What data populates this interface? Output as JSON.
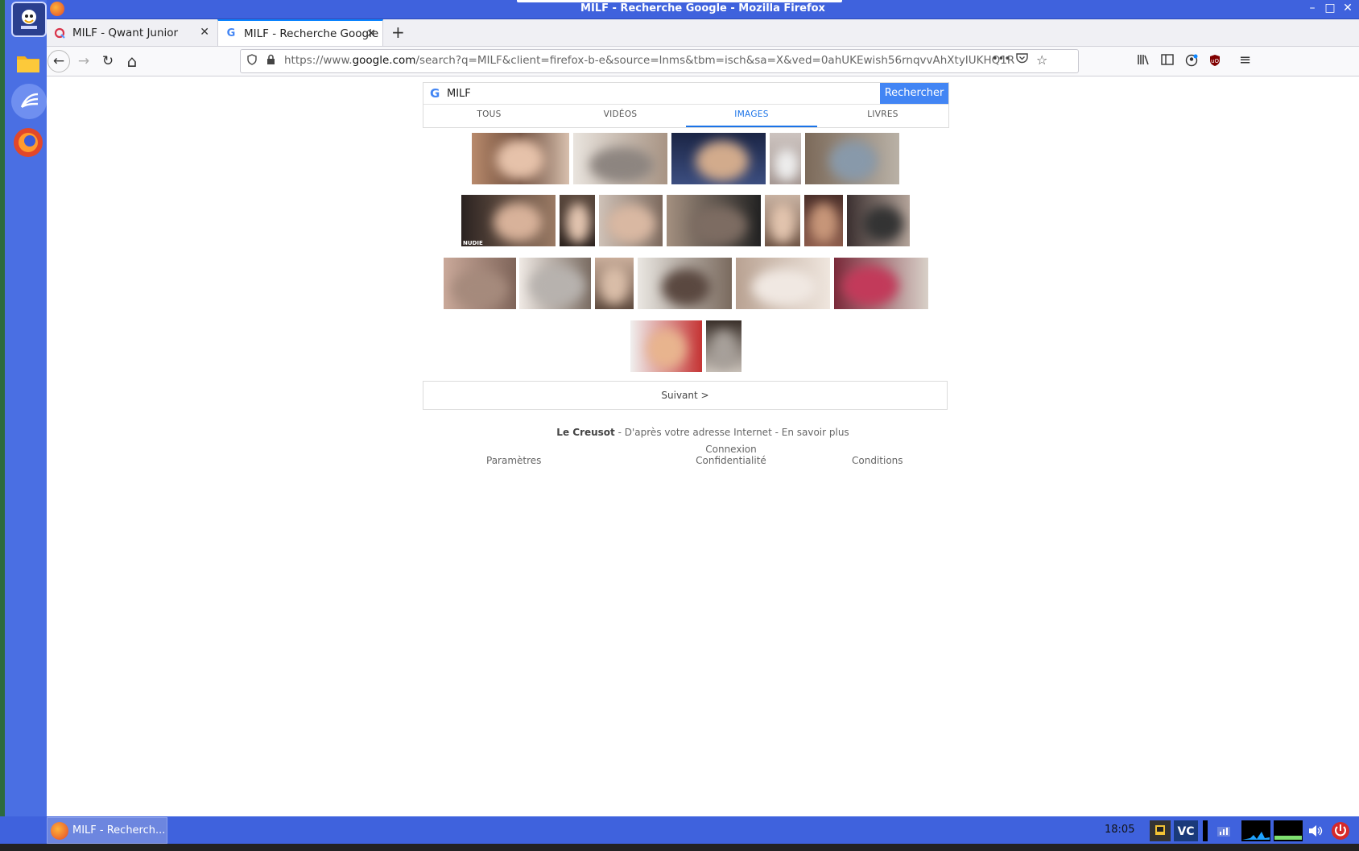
{
  "window": {
    "title": "MILF - Recherche Google - Mozilla Firefox",
    "minimize": "–",
    "maximize": "□",
    "close": "✕"
  },
  "tabs": [
    {
      "label": "MILF - Qwant Junior",
      "favicon": "Q",
      "close": "✕"
    },
    {
      "label": "MILF - Recherche Google",
      "favicon": "G",
      "close": "✕"
    }
  ],
  "new_tab": "+",
  "nav": {
    "back": "←",
    "forward": "→",
    "reload": "↻",
    "home": "⌂",
    "url_prefix": "https://www.",
    "url_host": "google.com",
    "url_rest": "/search?q=MILF&client=firefox-b-e&source=lnms&tbm=isch&sa=X&ved=0ahUKEwish56rnqvvAhXtyIUKHQ1R",
    "more": "•••",
    "pocket": "◡",
    "bookmark": "☆",
    "library": "|||\\",
    "sidebar": "▥",
    "account": "◉",
    "ublock": "◆",
    "menu": "≡"
  },
  "search": {
    "logo": "G",
    "query": "MILF",
    "button": "Rechercher",
    "tabs": [
      "TOUS",
      "VIDÉOS",
      "IMAGES",
      "LIVRES"
    ],
    "active_tab": "IMAGES"
  },
  "thumbnail_watermarks": [
    "NUDIE"
  ],
  "pagination": {
    "next": "Suivant >"
  },
  "footer": {
    "location": "Le Creusot",
    "location_rest": " - D'après votre adresse Internet - En savoir plus",
    "settings": "Paramètres",
    "login": "Connexion",
    "privacy": "Confidentialité",
    "terms": "Conditions"
  },
  "taskbar": {
    "task_label": "MILF - Recherch...",
    "clock": "18:05"
  }
}
